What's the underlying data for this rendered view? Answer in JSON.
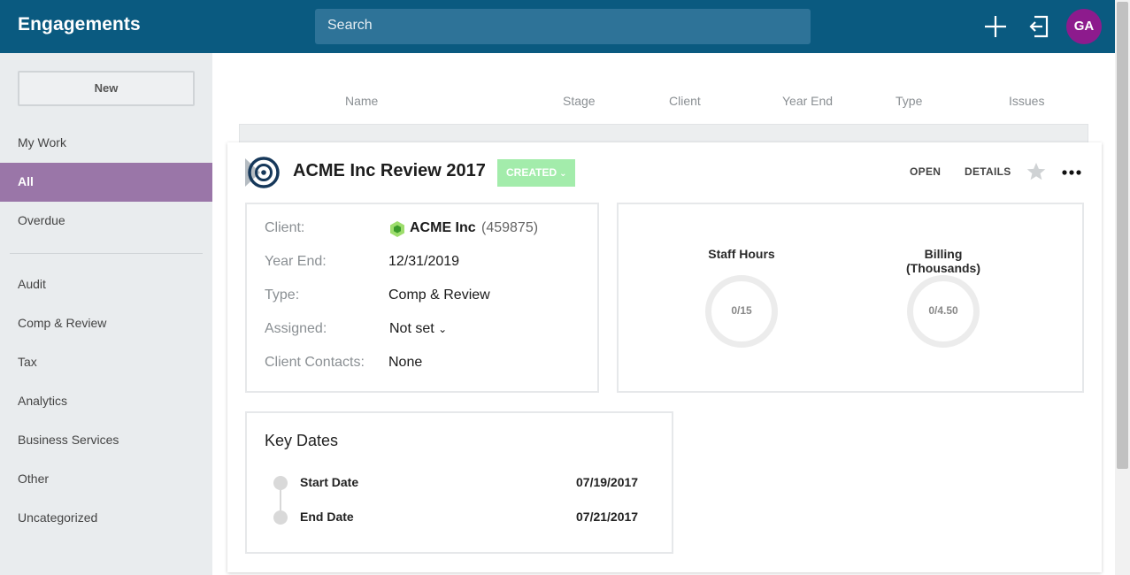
{
  "app": {
    "title": "Engagements",
    "user_initials": "GA",
    "avatar_color": "#8d1b8d",
    "brand_color": "#0a5a80"
  },
  "search": {
    "placeholder": "Search"
  },
  "sidebar": {
    "new_label": "New",
    "items": [
      {
        "label": "My Work"
      },
      {
        "label": "All",
        "active": true
      },
      {
        "label": "Overdue"
      },
      {
        "label": "Audit"
      },
      {
        "label": "Comp & Review"
      },
      {
        "label": "Tax"
      },
      {
        "label": "Analytics"
      },
      {
        "label": "Business Services"
      },
      {
        "label": "Other"
      },
      {
        "label": "Uncategorized"
      }
    ]
  },
  "table": {
    "columns": [
      "Name",
      "Stage",
      "Client",
      "Year End",
      "Type",
      "Issues"
    ]
  },
  "engagement": {
    "title": "ACME Inc Review 2017",
    "stage": "CREATED",
    "stage_color": "#a3ecab",
    "actions": {
      "open": "OPEN",
      "details": "DETAILS"
    },
    "info": {
      "client_label": "Client:",
      "client_name": "ACME Inc",
      "client_id": "(459875)",
      "year_end_label": "Year End:",
      "year_end": "12/31/2019",
      "type_label": "Type:",
      "type": "Comp & Review",
      "assigned_label": "Assigned:",
      "assigned": "Not set",
      "contacts_label": "Client Contacts:",
      "contacts": "None"
    },
    "metrics": [
      {
        "label": "Staff Hours",
        "value": "0/15"
      },
      {
        "label": "Billing (Thousands)",
        "value": "0/4.50"
      }
    ],
    "key_dates": {
      "title": "Key Dates",
      "items": [
        {
          "label": "Start Date",
          "date": "07/19/2017"
        },
        {
          "label": "End Date",
          "date": "07/21/2017"
        }
      ]
    }
  }
}
